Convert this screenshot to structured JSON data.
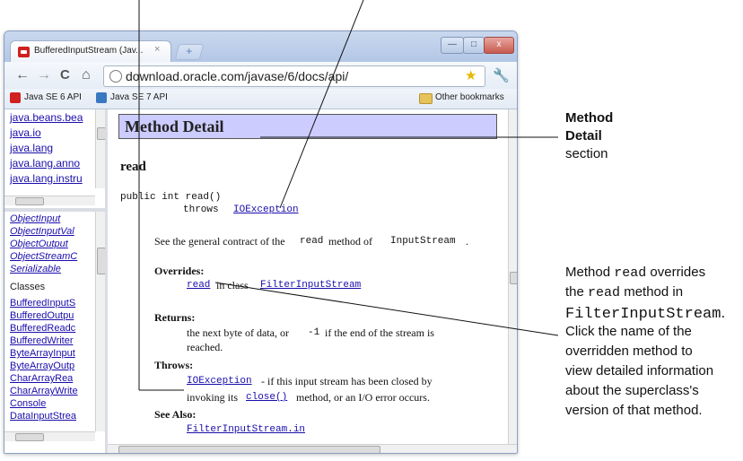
{
  "browser": {
    "tab_title": "BufferedInputStream (Jav...",
    "tab_close": "×",
    "new_tab": "+",
    "window_buttons": {
      "minimize": "—",
      "maximize": "□",
      "close": "x"
    },
    "nav": {
      "back": "←",
      "forward": "→",
      "reload": "C",
      "home": "⌂"
    },
    "url": "download.oracle.com/javase/6/docs/api/",
    "bookmarks": [
      "Java SE 6 API",
      "Java SE 7 API"
    ],
    "other_bookmarks": "Other bookmarks"
  },
  "packages": [
    "java.beans.bea",
    "java.io",
    "java.lang",
    "java.lang.anno",
    "java.lang.instru"
  ],
  "class_frame": {
    "interfaces": [
      "ObjectInput",
      "ObjectInputVal",
      "ObjectOutput",
      "ObjectStreamC",
      "Serializable"
    ],
    "classes_heading": "Classes",
    "classes": [
      "BufferedInputS",
      "BufferedOutpu",
      "BufferedReadc",
      "BufferedWriter",
      "ByteArrayInput",
      "ByteArrayOutp",
      "CharArrayRea",
      "CharArrayWrite",
      "Console",
      "DataInputStrea"
    ]
  },
  "doc": {
    "section_title": "Method Detail",
    "method_name": "read",
    "signature_line1": "public int read()",
    "throws_kw": "throws",
    "ioexception": "IOException",
    "desc_prefix": "See the general contract of the",
    "desc_read": "read",
    "desc_mid": "method of",
    "desc_class": "InputStream",
    "desc_end": ".",
    "overrides_label": "Overrides:",
    "overrides_method": "read",
    "overrides_in": "in class",
    "overrides_class": "FilterInputStream",
    "returns_label": "Returns:",
    "returns_line1_a": "the next byte of data, or",
    "returns_minus1": "-1",
    "returns_line1_b": "if the end of the stream is",
    "returns_line2": "reached.",
    "throws_label": "Throws:",
    "throws_exc": "IOException",
    "throws_line1": "- if this input stream has been closed by",
    "throws_line2_a": "invoking its",
    "throws_close": "close()",
    "throws_line2_b": "method, or an I/O error occurs.",
    "see_also_label": "See Also:",
    "see_also_link": "FilterInputStream.in"
  },
  "annotations": {
    "method_detail": [
      "Method",
      "Detail",
      "section"
    ],
    "overrides_note": {
      "line1_a": "Method ",
      "line1_code": "read",
      "line1_b": " overrides",
      "line2_a": "the ",
      "line2_code": "read",
      "line2_b": " method in",
      "line3_code": "FilterInputStream",
      "line3_b": ".",
      "line4": "Click the name of the",
      "line5": "overridden method to",
      "line6": "view detailed information",
      "line7": "about the superclass's",
      "line8": "version of that method."
    }
  }
}
